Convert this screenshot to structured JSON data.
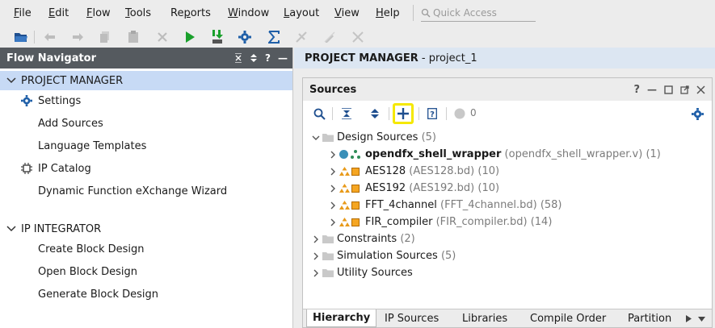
{
  "menu": [
    "File",
    "Edit",
    "Flow",
    "Tools",
    "Reports",
    "Window",
    "Layout",
    "View",
    "Help"
  ],
  "menu_mnemonics": [
    "F",
    "E",
    "F",
    "T",
    "p",
    "W",
    "L",
    "V",
    "H"
  ],
  "quick_access": {
    "placeholder": "Quick Access"
  },
  "toolbar": {
    "icons": [
      "open-project-icon",
      "undo-icon",
      "redo-icon",
      "copy-icon",
      "paste-icon",
      "delete-icon",
      "run-icon",
      "program-device-icon",
      "settings-icon",
      "sigma-icon",
      "disabled-icon-1",
      "disabled-icon-2",
      "disabled-icon-3"
    ]
  },
  "flow_navigator": {
    "title": "Flow Navigator",
    "sections": [
      {
        "label": "PROJECT MANAGER",
        "selected": true,
        "items": [
          {
            "label": "Settings",
            "icon": "gear-icon"
          },
          {
            "label": "Add Sources",
            "icon": ""
          },
          {
            "label": "Language Templates",
            "icon": ""
          },
          {
            "label": "IP Catalog",
            "icon": "ip-catalog-icon"
          },
          {
            "label": "Dynamic Function eXchange Wizard",
            "icon": ""
          }
        ]
      },
      {
        "label": "IP INTEGRATOR",
        "selected": false,
        "items": [
          {
            "label": "Create Block Design"
          },
          {
            "label": "Open Block Design"
          },
          {
            "label": "Generate Block Design"
          }
        ]
      }
    ]
  },
  "project_bar": {
    "title": "PROJECT MANAGER",
    "suffix": " - project_1"
  },
  "sources": {
    "title": "Sources",
    "status_count": "0",
    "tree": [
      {
        "label": "Design Sources",
        "detail": " (5)",
        "expanded": true
      },
      {
        "label": "opendfx_shell_wrapper",
        "detail": " (opendfx_shell_wrapper.v) (1)",
        "bold": true
      },
      {
        "label": "AES128",
        "detail": " (AES128.bd) (10)"
      },
      {
        "label": "AES192",
        "detail": " (AES192.bd) (10)"
      },
      {
        "label": "FFT_4channel",
        "detail": " (FFT_4channel.bd) (58)"
      },
      {
        "label": "FIR_compiler",
        "detail": " (FIR_compiler.bd) (14)"
      },
      {
        "label": "Constraints",
        "detail": " (2)"
      },
      {
        "label": "Simulation Sources",
        "detail": " (5)"
      },
      {
        "label": "Utility Sources",
        "detail": ""
      }
    ],
    "tabs": [
      "Hierarchy",
      "IP Sources",
      "Libraries",
      "Compile Order",
      "Partition"
    ],
    "active_tab": "Hierarchy"
  },
  "colors": {
    "navigator_header": "#555a5f",
    "selected_row": "#c7daf5",
    "project_bar": "#dce6f2",
    "highlight": "#f5e800",
    "accent_blue": "#1f5fa8",
    "run_green": "#1aa02c"
  }
}
